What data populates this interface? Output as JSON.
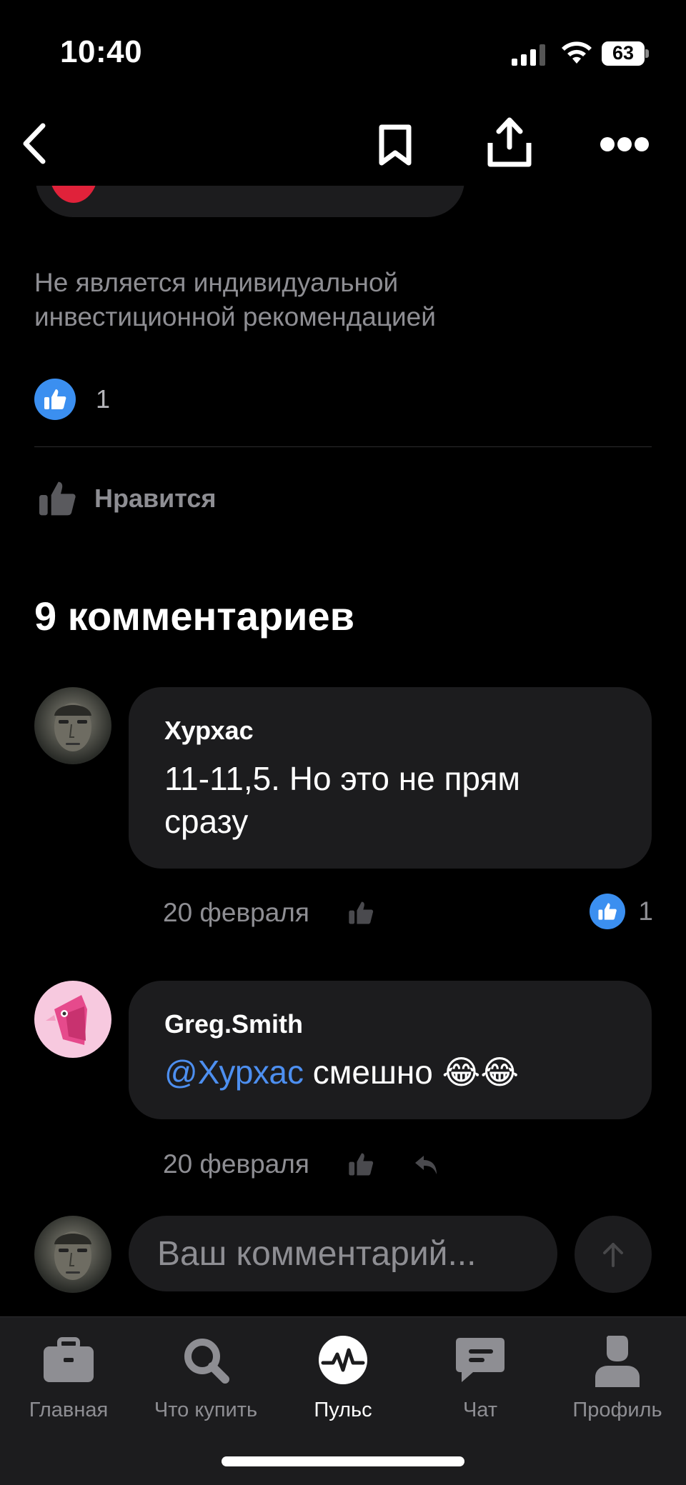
{
  "status_bar": {
    "time": "10:40",
    "battery": "63"
  },
  "post": {
    "disclaimer": "Не является индивидуальной инвестиционной рекомендацией",
    "reaction_count": "1",
    "like_label": "Нравится"
  },
  "comments_section": {
    "title": "9 комментариев",
    "comments": [
      {
        "author": "Хурхас",
        "text": "11-11,5. Но это не прям сразу",
        "date": "20 февраля",
        "like_count": "1"
      },
      {
        "author": "Greg.Smith",
        "mention": "@Хурхас",
        "text": " смешно 😂😂",
        "date": "20 февраля"
      }
    ]
  },
  "comment_input": {
    "placeholder": "Ваш комментарий..."
  },
  "tabbar": {
    "tabs": [
      {
        "label": "Главная",
        "icon": "briefcase-icon"
      },
      {
        "label": "Что купить",
        "icon": "search-icon"
      },
      {
        "label": "Пульс",
        "icon": "pulse-icon",
        "active": true
      },
      {
        "label": "Чат",
        "icon": "chat-icon"
      },
      {
        "label": "Профиль",
        "icon": "profile-icon"
      }
    ]
  },
  "colors": {
    "accent": "#3b8ff0",
    "mention": "#4d8ff0",
    "background": "#000000",
    "surface": "#1c1c1e",
    "muted": "#8e8e93"
  }
}
